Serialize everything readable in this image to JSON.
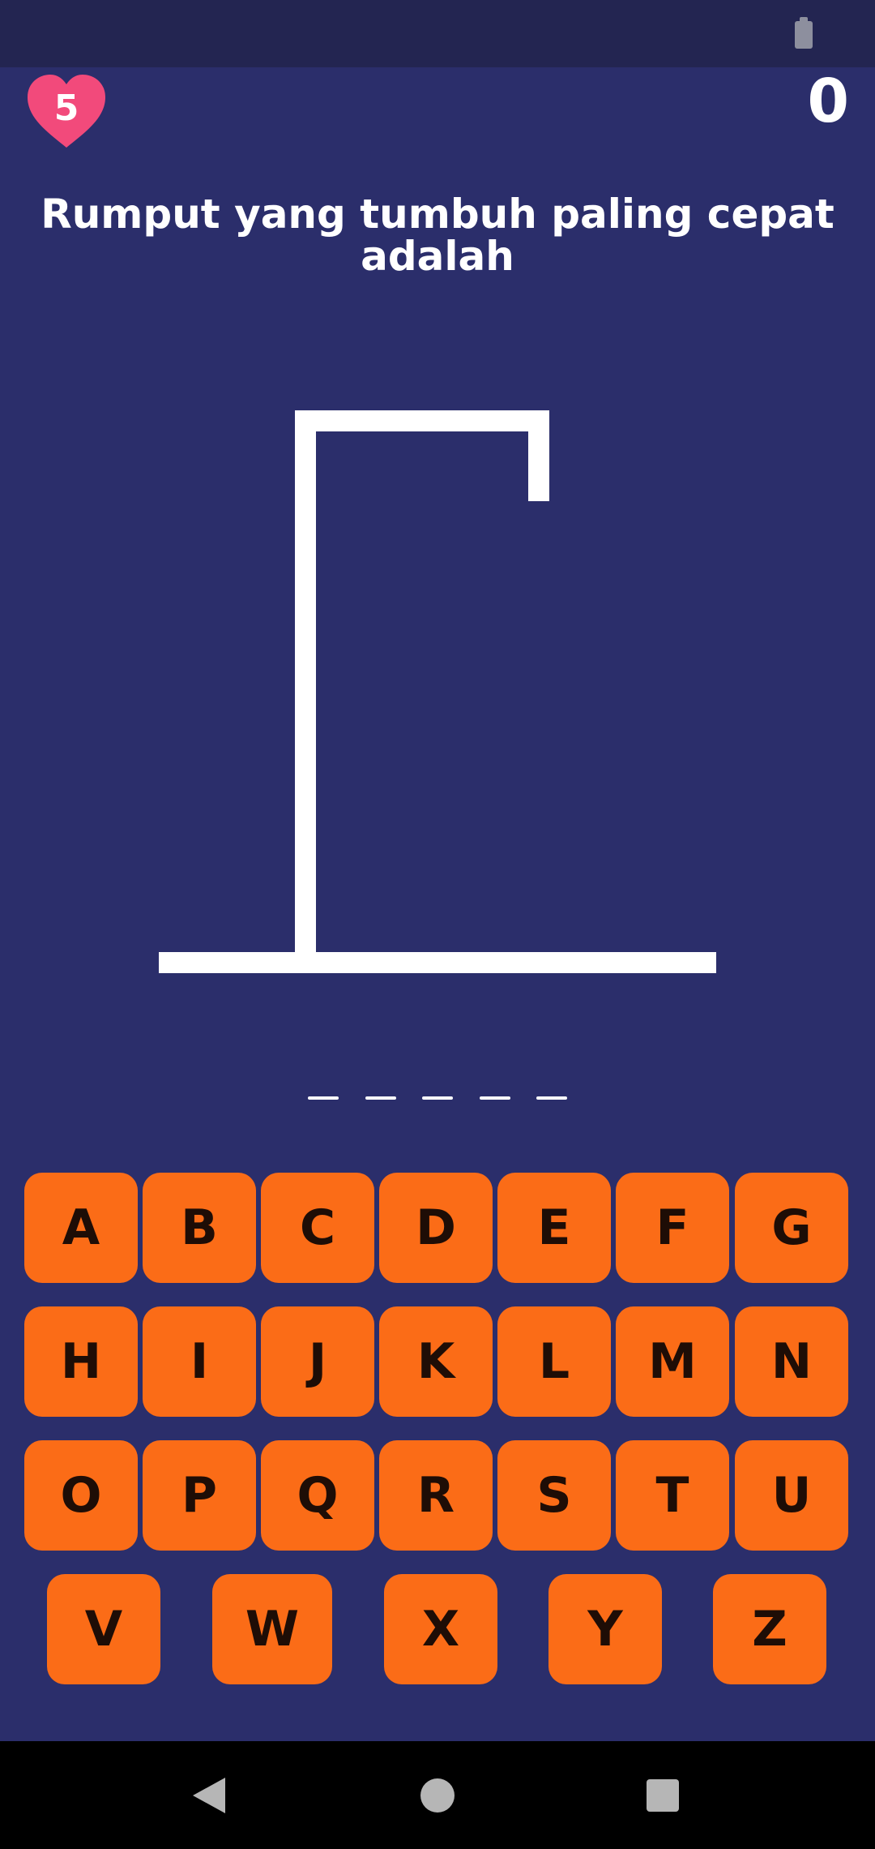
{
  "status_bar": {
    "battery_icon": "battery-icon"
  },
  "header": {
    "lives": "5",
    "lives_icon": "heart-icon",
    "lives_color": "#f24a7b",
    "score": "0"
  },
  "question": "Rumput yang tumbuh paling cepat adalah",
  "answer": {
    "letters_hidden": 5
  },
  "keyboard": {
    "color": "#fb6c17",
    "rows": [
      [
        "A",
        "B",
        "C",
        "D",
        "E",
        "F",
        "G"
      ],
      [
        "H",
        "I",
        "J",
        "K",
        "L",
        "M",
        "N"
      ],
      [
        "O",
        "P",
        "Q",
        "R",
        "S",
        "T",
        "U"
      ],
      [
        "V",
        "W",
        "X",
        "Y",
        "Z"
      ]
    ]
  },
  "nav_bar": {
    "back_icon": "back-triangle-icon",
    "home_icon": "home-circle-icon",
    "recent_icon": "recent-square-icon"
  },
  "colors": {
    "background": "#2b2e6b",
    "status_bar": "#232551",
    "key_text": "#1e0d06"
  }
}
